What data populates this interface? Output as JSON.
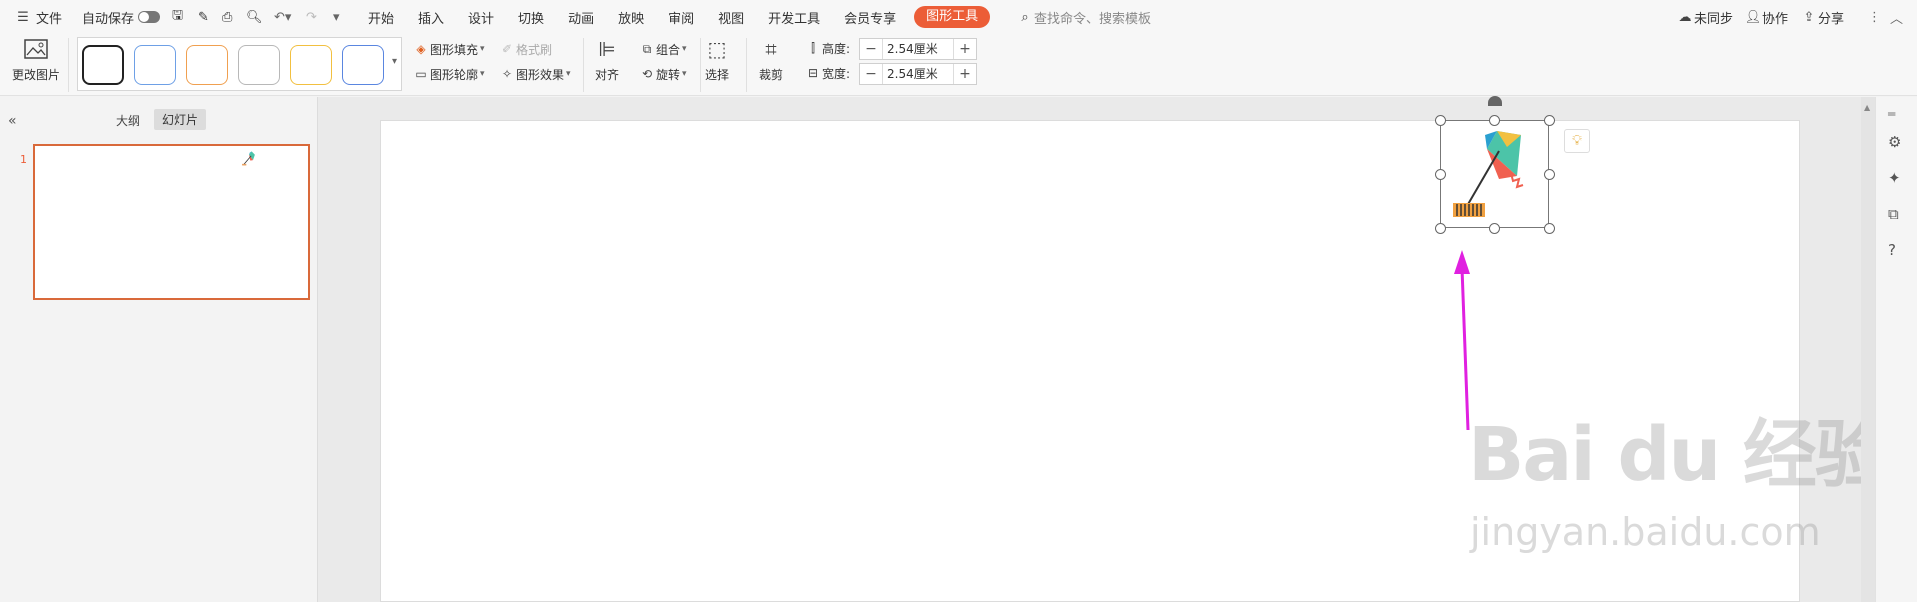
{
  "menubar": {
    "file_label": "文件",
    "autosave_label": "自动保存",
    "tabs": [
      "开始",
      "插入",
      "设计",
      "切换",
      "动画",
      "放映",
      "审阅",
      "视图",
      "开发工具",
      "会员专享",
      "图形工具"
    ],
    "search_placeholder": "查找命令、搜索模板",
    "unsync_label": "未同步",
    "collab_label": "协作",
    "share_label": "分享"
  },
  "ribbon": {
    "change_image_label": "更改图片",
    "fill_label": "图形填充",
    "outline_label": "图形轮廓",
    "format_brush_label": "格式刷",
    "effect_label": "图形效果",
    "align_label": "对齐",
    "group_label": "组合",
    "rotate_label": "旋转",
    "select_label": "选择",
    "crop_label": "裁剪",
    "height_label": "高度:",
    "height_value": "2.54厘米",
    "width_label": "宽度:",
    "width_value": "2.54厘米",
    "minus": "−",
    "plus": "+",
    "swatch_colors": [
      "#222222",
      "#6ea0e6",
      "#f0a050",
      "#b8b8b8",
      "#f2c040",
      "#5a86e0"
    ]
  },
  "leftpanel": {
    "collapse_icon": "«",
    "outline_tab": "大纲",
    "slides_tab": "幻灯片",
    "slide_number": "1"
  },
  "watermark": {
    "brand": "Bai du 经验",
    "url": "jingyan.baidu.com"
  },
  "colors": {
    "accent": "#ec5d37",
    "arrow": "#e020e0"
  }
}
